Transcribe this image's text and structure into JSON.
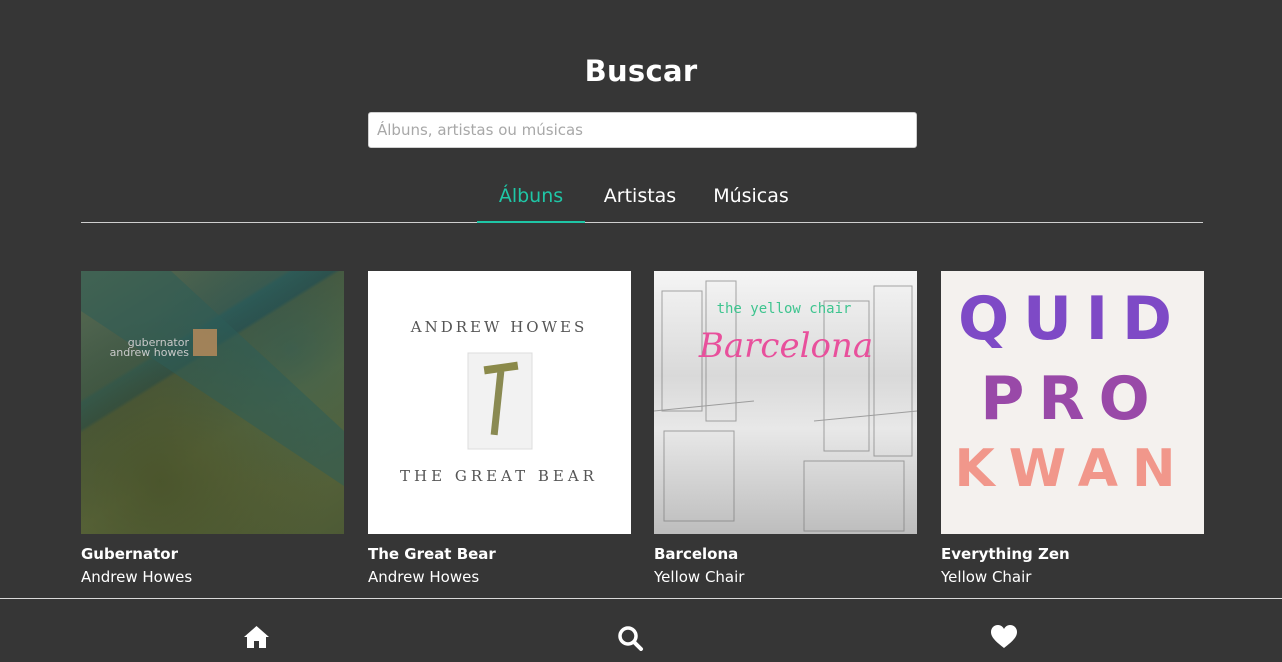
{
  "header": {
    "title": "Buscar"
  },
  "search": {
    "placeholder": "Álbuns, artistas ou músicas",
    "value": ""
  },
  "tabs": [
    {
      "label": "Álbuns",
      "active": true
    },
    {
      "label": "Artistas",
      "active": false
    },
    {
      "label": "Músicas",
      "active": false
    }
  ],
  "albums": [
    {
      "title": "Gubernator",
      "artist": "Andrew Howes",
      "cover_text": [
        "gubernator",
        "andrew howes"
      ]
    },
    {
      "title": "The Great Bear",
      "artist": "Andrew Howes",
      "cover_text": [
        "ANDREW HOWES",
        "THE GREAT BEAR"
      ]
    },
    {
      "title": "Barcelona",
      "artist": "Yellow Chair",
      "cover_text": [
        "the yellow chair",
        "Barcelona"
      ]
    },
    {
      "title": "Everything Zen",
      "artist": "Yellow Chair",
      "cover_text": [
        "QUID",
        "PRO",
        "KWAN"
      ]
    }
  ],
  "bottom_nav": [
    {
      "icon": "home-icon"
    },
    {
      "icon": "search-icon"
    },
    {
      "icon": "heart-icon"
    }
  ],
  "colors": {
    "background": "#363636",
    "accent": "#1fc6a6",
    "text": "#ffffff"
  }
}
